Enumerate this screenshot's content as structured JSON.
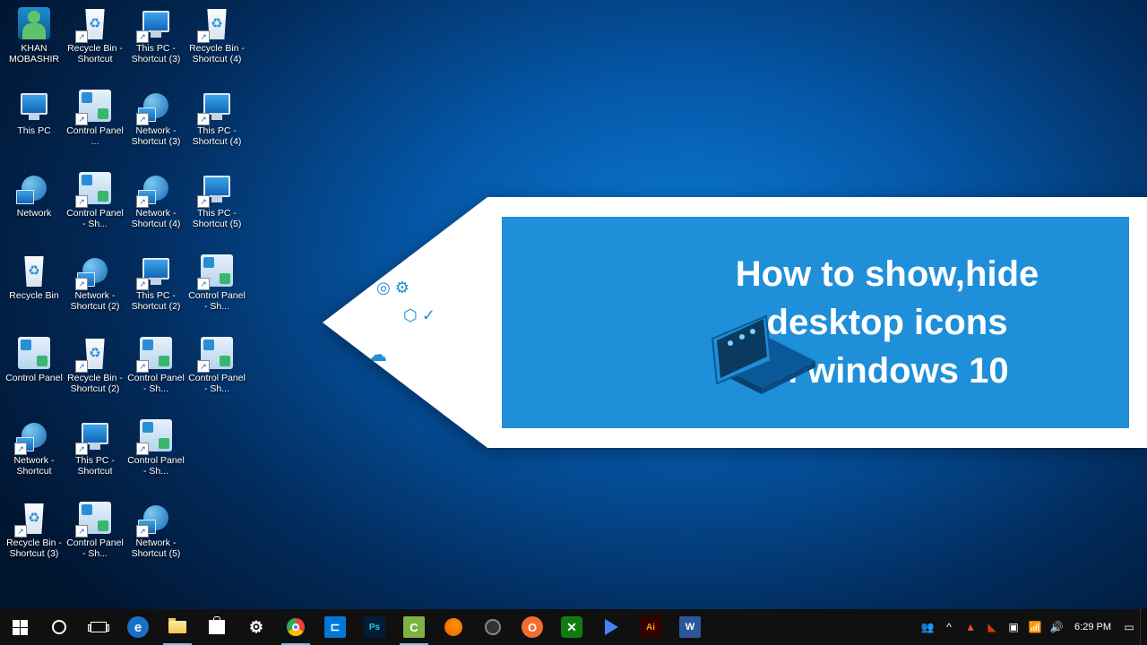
{
  "desktop_icons": [
    [
      {
        "label": "KHAN MOBASHIR",
        "type": "user",
        "shortcut": false
      },
      {
        "label": "Recycle Bin - Shortcut",
        "type": "recycle",
        "shortcut": true
      },
      {
        "label": "This PC - Shortcut (3)",
        "type": "pc",
        "shortcut": true
      },
      {
        "label": "Recycle Bin - Shortcut (4)",
        "type": "recycle",
        "shortcut": true
      }
    ],
    [
      {
        "label": "This PC",
        "type": "pc",
        "shortcut": false
      },
      {
        "label": "Control Panel ...",
        "type": "cp",
        "shortcut": true
      },
      {
        "label": "Network - Shortcut (3)",
        "type": "net",
        "shortcut": true
      },
      {
        "label": "This PC - Shortcut (4)",
        "type": "pc",
        "shortcut": true
      }
    ],
    [
      {
        "label": "Network",
        "type": "net",
        "shortcut": false
      },
      {
        "label": "Control Panel - Sh...",
        "type": "cp",
        "shortcut": true
      },
      {
        "label": "Network - Shortcut (4)",
        "type": "net",
        "shortcut": true
      },
      {
        "label": "This PC - Shortcut (5)",
        "type": "pc",
        "shortcut": true
      }
    ],
    [
      {
        "label": "Recycle Bin",
        "type": "recycle",
        "shortcut": false
      },
      {
        "label": "Network - Shortcut (2)",
        "type": "net",
        "shortcut": true
      },
      {
        "label": "This PC - Shortcut (2)",
        "type": "pc",
        "shortcut": true
      },
      {
        "label": "Control Panel - Sh...",
        "type": "cp",
        "shortcut": true
      }
    ],
    [
      {
        "label": "Control Panel",
        "type": "cp",
        "shortcut": false
      },
      {
        "label": "Recycle Bin - Shortcut (2)",
        "type": "recycle",
        "shortcut": true
      },
      {
        "label": "Control Panel - Sh...",
        "type": "cp",
        "shortcut": true
      },
      {
        "label": "Control Panel - Sh...",
        "type": "cp",
        "shortcut": true
      }
    ],
    [
      {
        "label": "Network - Shortcut",
        "type": "net",
        "shortcut": true
      },
      {
        "label": "This PC - Shortcut",
        "type": "pc",
        "shortcut": true
      },
      {
        "label": "Control Panel - Sh...",
        "type": "cp",
        "shortcut": true
      }
    ],
    [
      {
        "label": "Recycle Bin - Shortcut (3)",
        "type": "recycle",
        "shortcut": true
      },
      {
        "label": "Control Panel - Sh...",
        "type": "cp",
        "shortcut": true
      },
      {
        "label": "Network - Shortcut (5)",
        "type": "net",
        "shortcut": true
      }
    ]
  ],
  "banner": {
    "title_line1": "How to show,hide desktop icons",
    "title_line2": "in windows 10"
  },
  "taskbar": {
    "apps": [
      {
        "name": "start",
        "icon": "win"
      },
      {
        "name": "cortana",
        "icon": "circle"
      },
      {
        "name": "task-view",
        "icon": "taskview"
      },
      {
        "name": "edge",
        "icon": "edge"
      },
      {
        "name": "file-explorer",
        "icon": "folder",
        "running": true
      },
      {
        "name": "store",
        "icon": "store"
      },
      {
        "name": "settings",
        "icon": "gear"
      },
      {
        "name": "chrome",
        "icon": "chrome",
        "running": true
      },
      {
        "name": "vscode",
        "icon": "vscode"
      },
      {
        "name": "photoshop",
        "icon": "ps"
      },
      {
        "name": "camtasia",
        "icon": "camtasia",
        "running": true
      },
      {
        "name": "firefox",
        "icon": "firefox"
      },
      {
        "name": "obs",
        "icon": "obs"
      },
      {
        "name": "origin",
        "icon": "origin"
      },
      {
        "name": "xbox",
        "icon": "xbox"
      },
      {
        "name": "play",
        "icon": "play"
      },
      {
        "name": "illustrator",
        "icon": "ai"
      },
      {
        "name": "word",
        "icon": "word"
      }
    ],
    "tray": [
      {
        "name": "people",
        "glyph": "👥"
      },
      {
        "name": "chevron",
        "glyph": "^"
      },
      {
        "name": "tray-app1",
        "glyph": "▲",
        "color": "#e84b2c"
      },
      {
        "name": "tray-app2",
        "glyph": "◣",
        "color": "#d83b01"
      },
      {
        "name": "tray-defender",
        "glyph": "▣"
      },
      {
        "name": "network",
        "glyph": "📶"
      },
      {
        "name": "volume",
        "glyph": "🔊"
      }
    ],
    "clock_time": "6:29 PM",
    "notifications": "▭"
  }
}
